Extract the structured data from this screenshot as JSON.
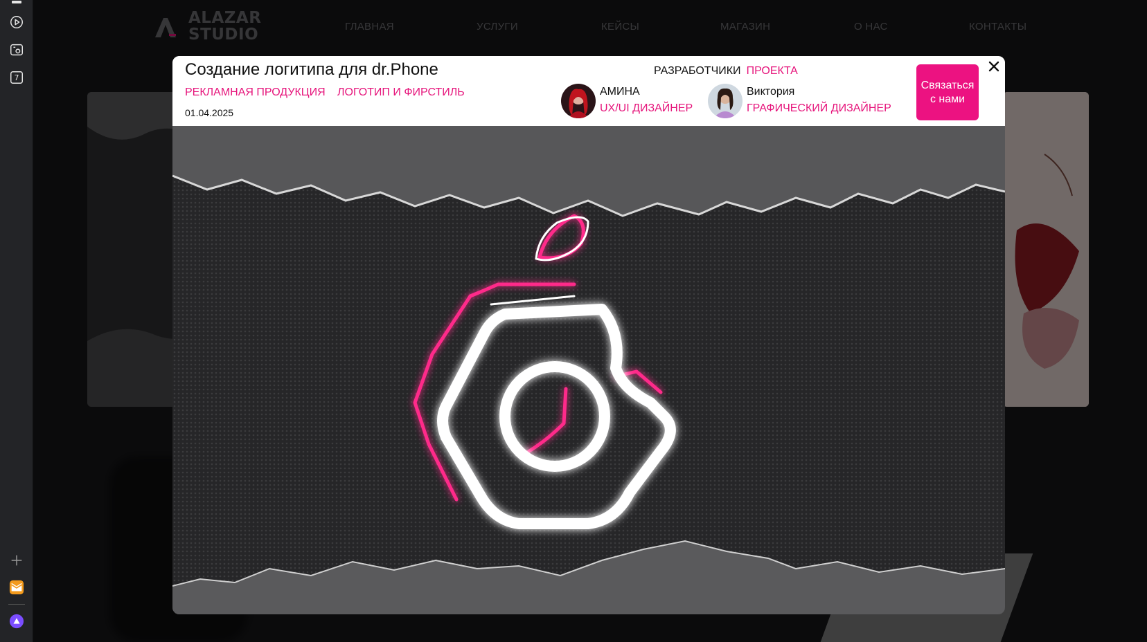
{
  "sidebar": {
    "icons": [
      "play-circle-icon",
      "screenshot-icon",
      "calendar-icon",
      "plus-icon",
      "mail-app-icon",
      "assistant-icon"
    ],
    "calendar_day": "7"
  },
  "site": {
    "logo_line1": "ALAZAR",
    "logo_line2": "STUDIO",
    "nav": [
      "ГЛАВНАЯ",
      "УСЛУГИ",
      "КЕЙСЫ",
      "МАГАЗИН",
      "О НАС",
      "КОНТАКТЫ"
    ]
  },
  "modal": {
    "title": "Создание логитипа для dr.Phone",
    "tags": [
      "РЕКЛАМНАЯ ПРОДУКЦИЯ",
      "ЛОГОТИП И ФИРСТИЛЬ"
    ],
    "date": "01.04.2025",
    "devs_heading_part1": "РАЗРАБОТЧИКИ",
    "devs_heading_part2": "ПРОЕКТА",
    "developers": [
      {
        "name": "АМИНА",
        "role": "UX/UI ДИЗАЙНЕР"
      },
      {
        "name": "Виктория",
        "role": "ГРАФИЧЕСКИЙ ДИЗАЙНЕР"
      }
    ],
    "contact_label": "Связаться с нами",
    "close_glyph": "✕"
  },
  "colors": {
    "accent": "#ec1281",
    "page_bg": "#171719",
    "nav_text": "#6e6e72"
  }
}
